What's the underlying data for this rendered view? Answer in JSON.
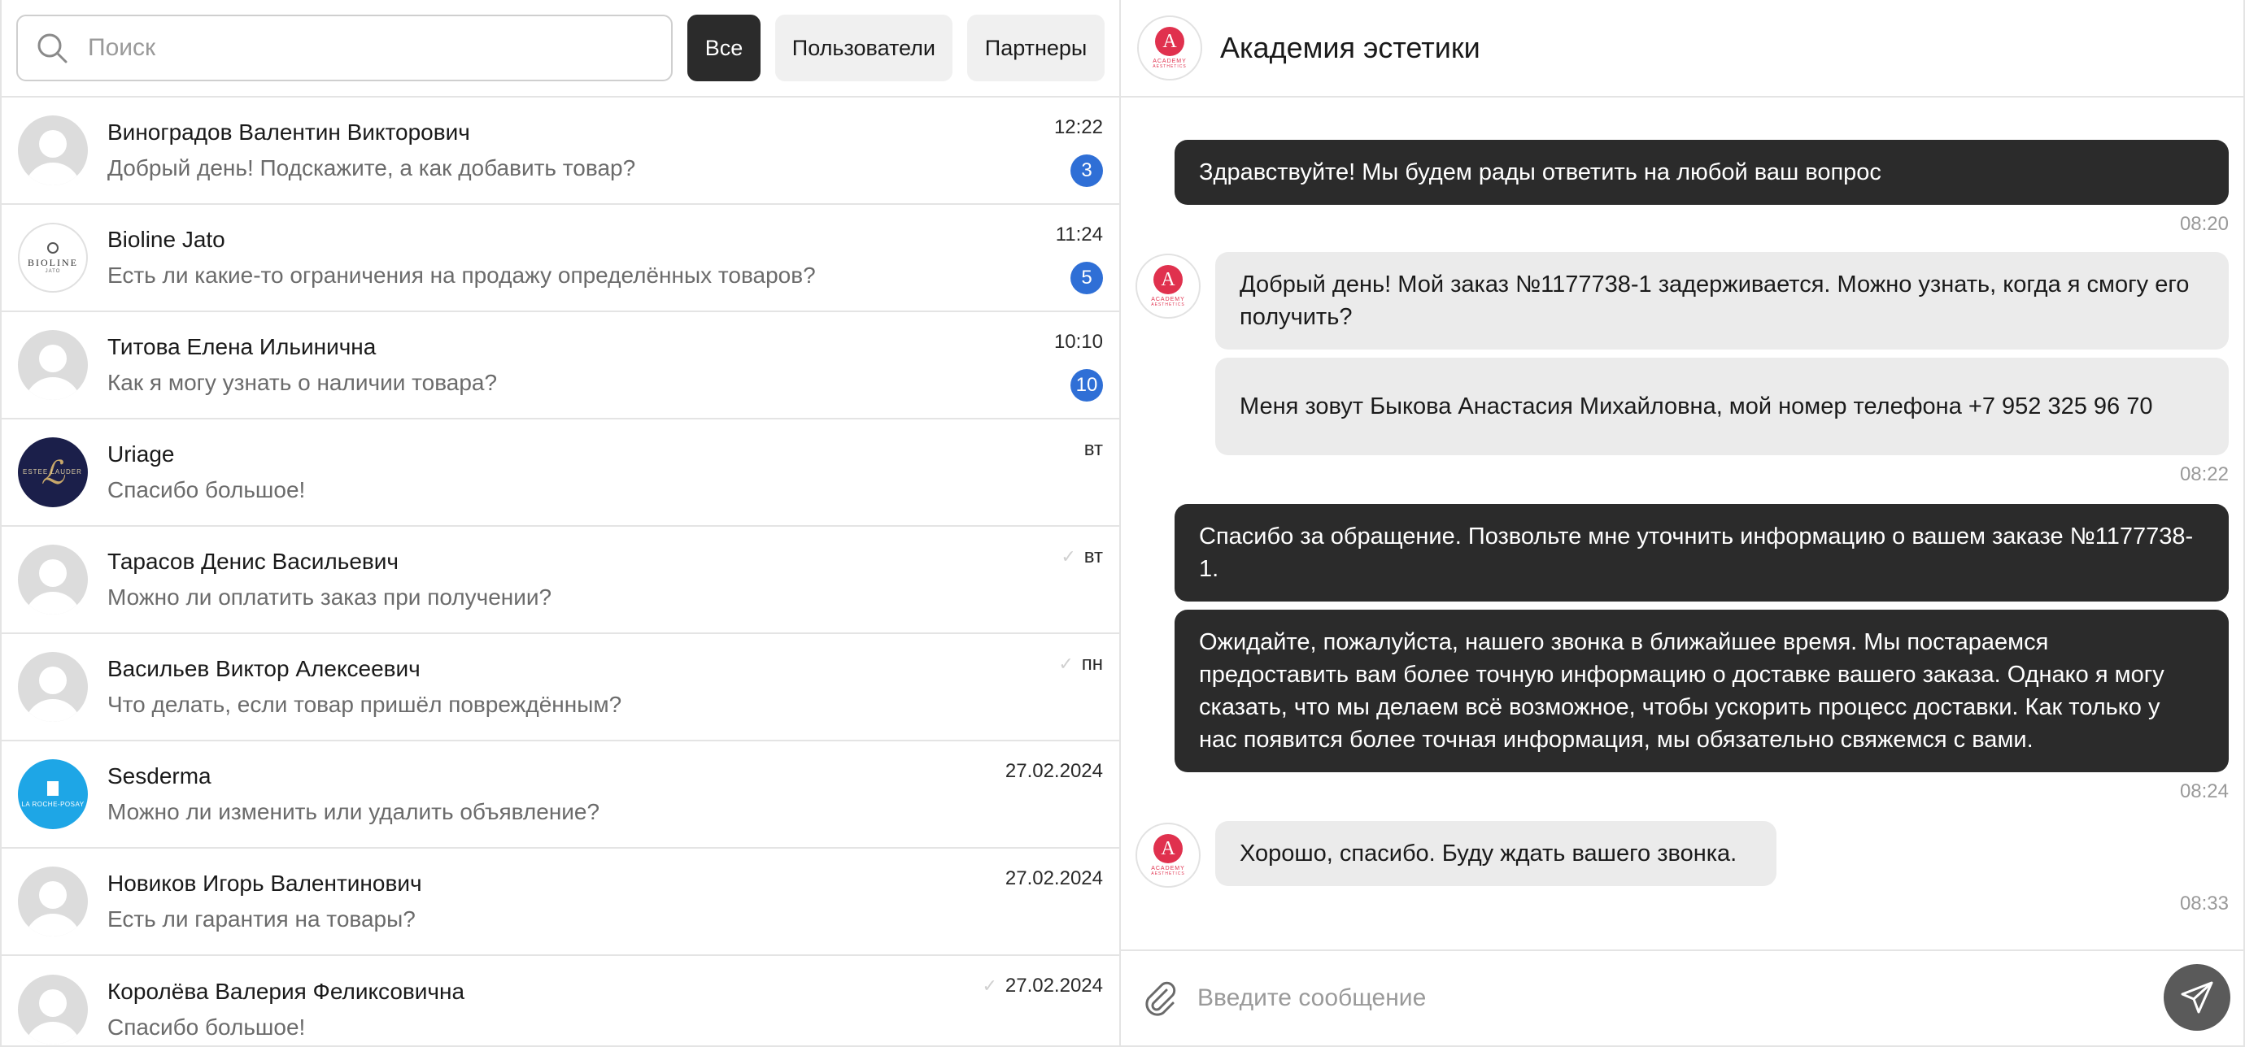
{
  "search": {
    "placeholder": "Поиск"
  },
  "filters": {
    "all": "Все",
    "users": "Пользователи",
    "partners": "Партнеры"
  },
  "chats": [
    {
      "name": "Виноградов Валентин Викторович",
      "message": "Добрый день! Подскажите, а как добавить товар?",
      "time": "12:22",
      "unread": "3",
      "avatar": "default-user-avatar"
    },
    {
      "name": "Bioline Jato",
      "message": "Есть ли какие-то ограничения на продажу определённых товаров?",
      "time": "11:24",
      "unread": "5",
      "avatar": "bioline-logo",
      "avatar_text": "BIOLINE",
      "avatar_sub": "JATO"
    },
    {
      "name": "Титова Елена Ильинична",
      "message": "Как я могу узнать о наличии товара?",
      "time": "10:10",
      "unread": "10",
      "avatar": "default-user-avatar"
    },
    {
      "name": "Uriage",
      "message": "Спасибо большое!",
      "time": "вт",
      "avatar": "uriage-logo",
      "avatar_text": "ESTEE LAUDER"
    },
    {
      "name": "Тарасов Денис Васильевич",
      "message": "Можно ли оплатить заказ при получении?",
      "time": "вт",
      "read_check": true,
      "avatar": "default-user-avatar"
    },
    {
      "name": "Васильев Виктор Алексеевич",
      "message": "Что делать, если товар пришёл повреждённым?",
      "time": "пн",
      "read_check": true,
      "avatar": "default-user-avatar"
    },
    {
      "name": "Sesderma",
      "message": "Можно ли изменить или удалить объявление?",
      "time": "27.02.2024",
      "avatar": "sesderma-logo",
      "avatar_text": "LA ROCHE-POSAY"
    },
    {
      "name": "Новиков Игорь Валентинович",
      "message": "Есть ли гарантия на товары?",
      "time": "27.02.2024",
      "avatar": "default-user-avatar"
    },
    {
      "name": "Королёва Валерия Феликсовична",
      "message": "Спасибо большое!",
      "time": "27.02.2024",
      "read_check": true,
      "avatar": "default-user-avatar"
    }
  ],
  "conversation": {
    "title": "Академия эстетики",
    "logo": {
      "letter": "A",
      "text": "ACADEMY",
      "sub": "AESTHETICS"
    },
    "messages": [
      {
        "direction": "out",
        "text": "Здравствуйте! Мы будем рады ответить на любой ваш вопрос",
        "time": "08:20"
      },
      {
        "direction": "in",
        "text": "Добрый день! Мой заказ №1177738-1 задерживается. Можно узнать, когда я смогу его получить?"
      },
      {
        "direction": "in",
        "text": "Меня зовут Быкова Анастасия Михайловна, мой номер телефона +7 952 325 96 70",
        "time": "08:22"
      },
      {
        "direction": "out",
        "text": "Спасибо за обращение. Позвольте мне уточнить информацию о вашем заказе №1177738-1."
      },
      {
        "direction": "out",
        "text": "Ожидайте, пожалуйста, нашего звонка в ближайшее время. Мы постараемся предоставить вам более точную информацию о доставке вашего заказа. Однако я могу сказать, что мы делаем всё возможное, чтобы ускорить процесс доставки. Как только у нас появится более точная информация, мы обязательно свяжемся с вами.",
        "time": "08:24"
      },
      {
        "direction": "in",
        "text": "Хорошо, спасибо. Буду ждать вашего звонка.",
        "time": "08:33"
      }
    ]
  },
  "composer": {
    "placeholder": "Введите сообщение"
  },
  "icons": {
    "search": "search-icon",
    "attach": "paperclip-icon",
    "send": "send-icon",
    "read": "check-icon"
  },
  "colors": {
    "accent": "#2f6fd6",
    "outgoing_bubble": "#2b2b2b",
    "incoming_bubble": "#ebebeb",
    "logo_red": "#e0314e"
  }
}
